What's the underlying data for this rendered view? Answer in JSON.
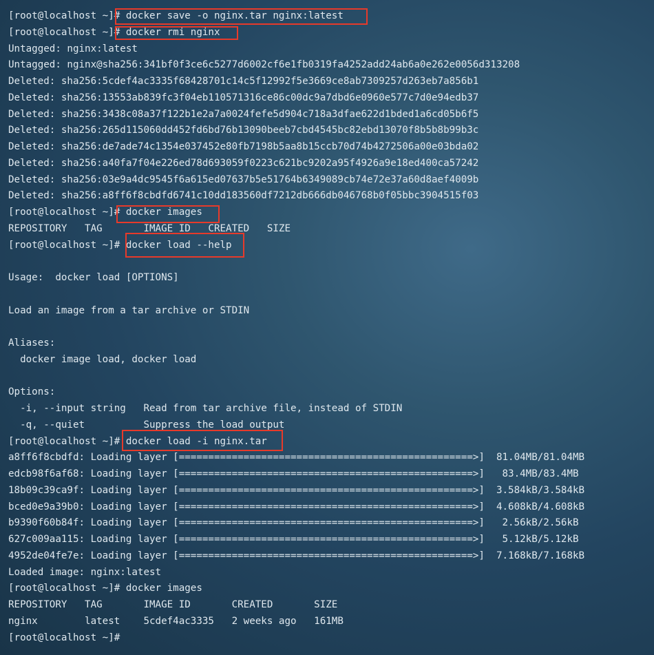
{
  "terminal": {
    "lines": [
      "[root@localhost ~]# docker save -o nginx.tar nginx:latest",
      "[root@localhost ~]# docker rmi nginx",
      "Untagged: nginx:latest",
      "Untagged: nginx@sha256:341bf0f3ce6c5277d6002cf6e1fb0319fa4252add24ab6a0e262e0056d313208",
      "Deleted: sha256:5cdef4ac3335f68428701c14c5f12992f5e3669ce8ab7309257d263eb7a856b1",
      "Deleted: sha256:13553ab839fc3f04eb110571316ce86c00dc9a7dbd6e0960e577c7d0e94edb37",
      "Deleted: sha256:3438c08a37f122b1e2a7a0024fefe5d904c718a3dfae622d1bded1a6cd05b6f5",
      "Deleted: sha256:265d115060dd452fd6bd76b13090beeb7cbd4545bc82ebd13070f8b5b8b99b3c",
      "Deleted: sha256:de7ade74c1354e037452e80fb7198b5aa8b15ccb70d74b4272506a00e03bda02",
      "Deleted: sha256:a40fa7f04e226ed78d693059f0223c621bc9202a95f4926a9e18ed400ca57242",
      "Deleted: sha256:03e9a4dc9545f6a615ed07637b5e51764b6349089cb74e72e37a60d8aef4009b",
      "Deleted: sha256:a8ff6f8cbdfd6741c10dd183560df7212db666db046768b0f05bbc3904515f03",
      "[root@localhost ~]# docker images",
      "REPOSITORY   TAG       IMAGE ID   CREATED   SIZE",
      "[root@localhost ~]# docker load --help",
      "",
      "Usage:  docker load [OPTIONS]",
      "",
      "Load an image from a tar archive or STDIN",
      "",
      "Aliases:",
      "  docker image load, docker load",
      "",
      "Options:",
      "  -i, --input string   Read from tar archive file, instead of STDIN",
      "  -q, --quiet          Suppress the load output",
      "[root@localhost ~]# docker load -i nginx.tar",
      "a8ff6f8cbdfd: Loading layer [==================================================>]  81.04MB/81.04MB",
      "edcb98f6af68: Loading layer [==================================================>]   83.4MB/83.4MB",
      "18b09c39ca9f: Loading layer [==================================================>]  3.584kB/3.584kB",
      "bced0e9a39b0: Loading layer [==================================================>]  4.608kB/4.608kB",
      "b9390f60b84f: Loading layer [==================================================>]   2.56kB/2.56kB",
      "627c009aa115: Loading layer [==================================================>]   5.12kB/5.12kB",
      "4952de04fe7e: Loading layer [==================================================>]  7.168kB/7.168kB",
      "Loaded image: nginx:latest",
      "[root@localhost ~]# docker images",
      "REPOSITORY   TAG       IMAGE ID       CREATED       SIZE",
      "nginx        latest    5cdef4ac3335   2 weeks ago   161MB",
      "[root@localhost ~]#"
    ],
    "highlight_color": "#e83a2a",
    "text_color": "#dfe8ee"
  }
}
